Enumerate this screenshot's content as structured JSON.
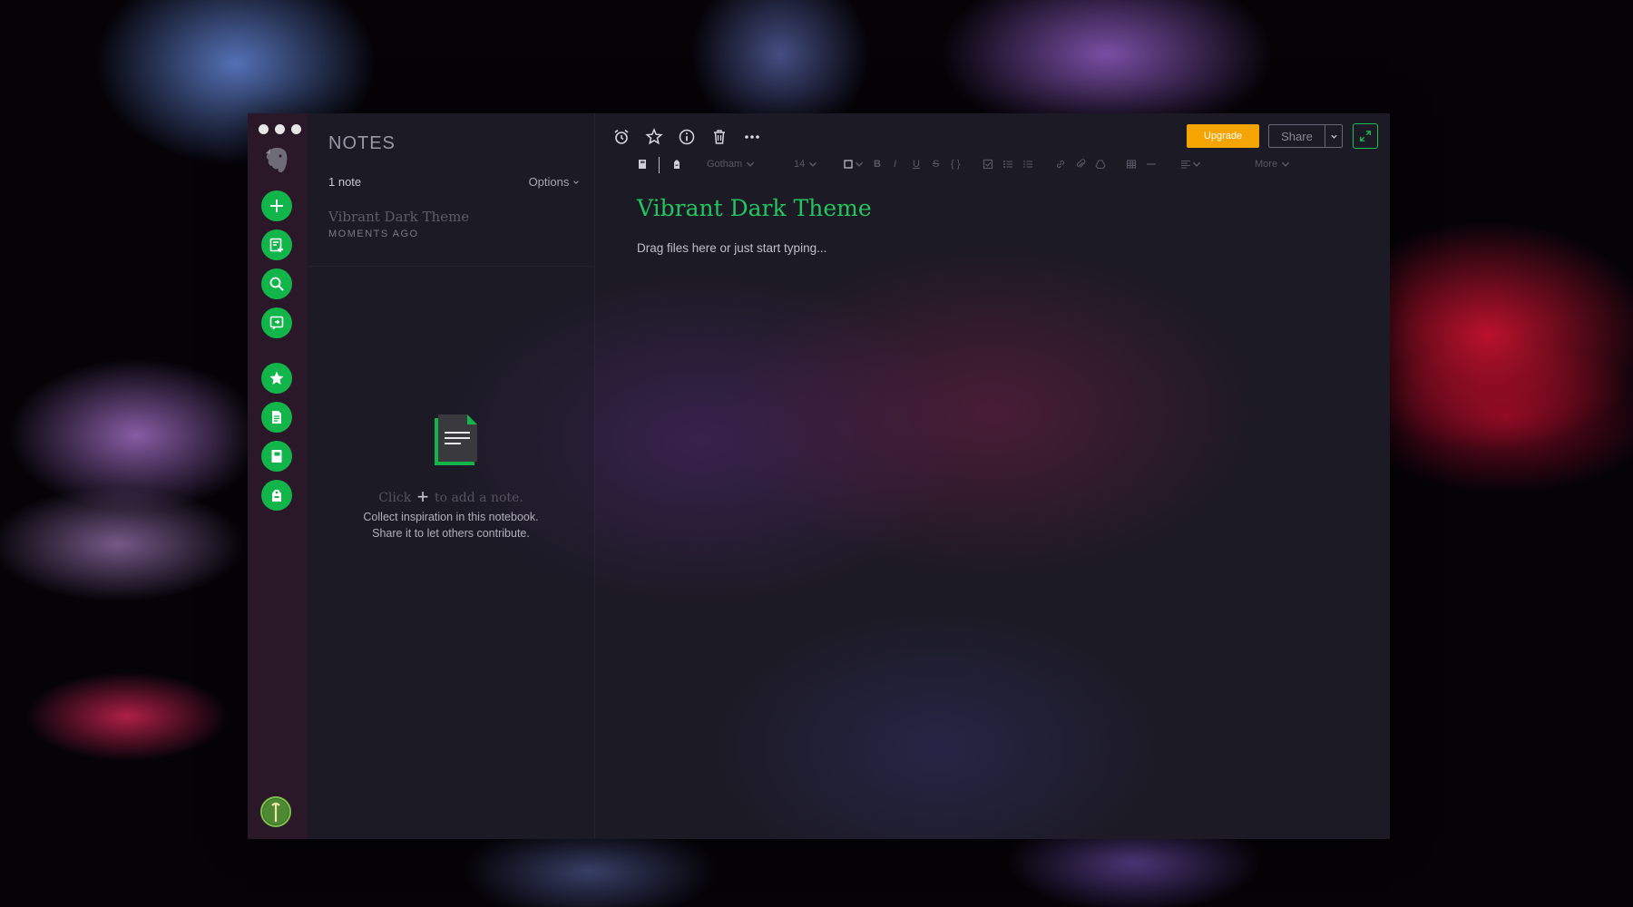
{
  "window": {
    "traffic_lights": [
      "close",
      "minimize",
      "zoom"
    ]
  },
  "sidebar": {
    "logo": "evernote-elephant-icon",
    "buttons": [
      {
        "name": "new-note",
        "icon": "plus-icon"
      },
      {
        "name": "new-chat",
        "icon": "note-add-icon"
      },
      {
        "name": "search",
        "icon": "search-icon"
      },
      {
        "name": "work-chat",
        "icon": "chat-icon"
      },
      {
        "name": "shortcuts",
        "icon": "star-icon"
      },
      {
        "name": "notes",
        "icon": "notes-icon"
      },
      {
        "name": "notebooks",
        "icon": "notebook-icon"
      },
      {
        "name": "tags",
        "icon": "tag-icon"
      }
    ],
    "avatar": "user-avatar-icon",
    "accent": "#12b54a"
  },
  "notes_list": {
    "title": "NOTES",
    "count": "1 note",
    "options_label": "Options",
    "items": [
      {
        "title": "Vibrant Dark Theme",
        "time": "MOMENTS AGO"
      }
    ],
    "empty": {
      "line1_before": "Click",
      "line1_plus": "+",
      "line1_after": "to add a note.",
      "line2": "Collect inspiration in this notebook.",
      "line3": "Share it to let others contribute."
    }
  },
  "toolbar": {
    "icons": [
      "reminder-icon",
      "star-icon",
      "info-icon",
      "trash-icon",
      "more-dots-icon"
    ],
    "upgrade_label": "Upgrade",
    "share_label": "Share",
    "upgrade_color": "#f5a400"
  },
  "format_bar": {
    "font": "Gotham",
    "size": "14",
    "bold": "B",
    "italic": "I",
    "underline": "U",
    "strike": "S",
    "code": "{ }",
    "more_label": "More"
  },
  "editor": {
    "title": "Vibrant Dark Theme",
    "placeholder": "Drag files here or just start typing..."
  }
}
